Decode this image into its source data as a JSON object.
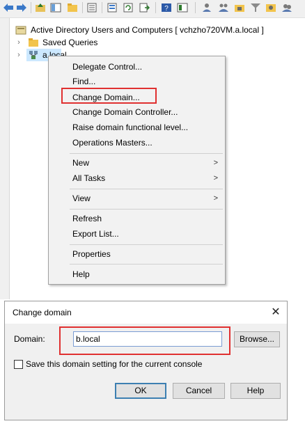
{
  "tree": {
    "root_label": "Active Directory Users and Computers [ vchzho720VM.a.local ]",
    "items": [
      {
        "label": "Saved Queries"
      },
      {
        "label": "a.local"
      }
    ]
  },
  "context_menu": {
    "items": [
      {
        "label": "Delegate Control..."
      },
      {
        "label": "Find..."
      },
      {
        "label": "Change Domain..."
      },
      {
        "label": "Change Domain Controller..."
      },
      {
        "label": "Raise domain functional level..."
      },
      {
        "label": "Operations Masters..."
      },
      {
        "label": "New"
      },
      {
        "label": "All Tasks"
      },
      {
        "label": "View"
      },
      {
        "label": "Refresh"
      },
      {
        "label": "Export List..."
      },
      {
        "label": "Properties"
      },
      {
        "label": "Help"
      }
    ]
  },
  "dialog": {
    "title": "Change domain",
    "domain_label": "Domain:",
    "domain_value": "b.local",
    "browse_label": "Browse...",
    "checkbox_label": "Save this domain setting for the current console",
    "checkbox_checked": false,
    "ok_label": "OK",
    "cancel_label": "Cancel",
    "help_label": "Help"
  },
  "colors": {
    "highlight": "#e03030",
    "accent": "#3c7fb1"
  }
}
